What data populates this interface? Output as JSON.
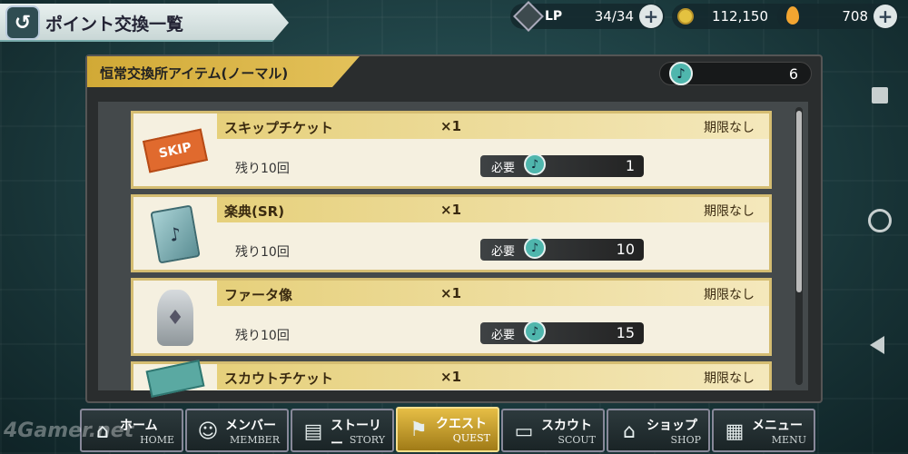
{
  "header": {
    "title": "ポイント交換一覧",
    "back_icon": "↺",
    "lp": {
      "label": "LP",
      "value": "34/34"
    },
    "coins": {
      "value": "112,150"
    },
    "gems": {
      "value": "708"
    },
    "plus": "+"
  },
  "panel": {
    "tab_label": "恒常交換所アイテム(ノーマル)",
    "points": "6",
    "note_glyph": "♪"
  },
  "items": [
    {
      "name": "スキップチケット",
      "qty": "×1",
      "limit": "期限なし",
      "remaining": "残り10回",
      "req_label": "必要",
      "req_value": "1",
      "thumb_text": "SKIP"
    },
    {
      "name": "楽典(SR)",
      "qty": "×1",
      "limit": "期限なし",
      "remaining": "残り10回",
      "req_label": "必要",
      "req_value": "10"
    },
    {
      "name": "ファータ像",
      "qty": "×1",
      "limit": "期限なし",
      "remaining": "残り10回",
      "req_label": "必要",
      "req_value": "15"
    },
    {
      "name": "スカウトチケット",
      "qty": "×1",
      "limit": "期限なし"
    }
  ],
  "nav": [
    {
      "jp": "ホーム",
      "en": "HOME",
      "icon": "⌂"
    },
    {
      "jp": "メンバー",
      "en": "MEMBER",
      "icon": "☺"
    },
    {
      "jp": "ストーリー",
      "en": "STORY",
      "icon": "▤"
    },
    {
      "jp": "クエスト",
      "en": "QUEST",
      "icon": "⚑"
    },
    {
      "jp": "スカウト",
      "en": "SCOUT",
      "icon": "▭"
    },
    {
      "jp": "ショップ",
      "en": "SHOP",
      "icon": "⌂"
    },
    {
      "jp": "メニュー",
      "en": "MENU",
      "icon": "▦"
    }
  ],
  "watermark": "4Gamer.net"
}
